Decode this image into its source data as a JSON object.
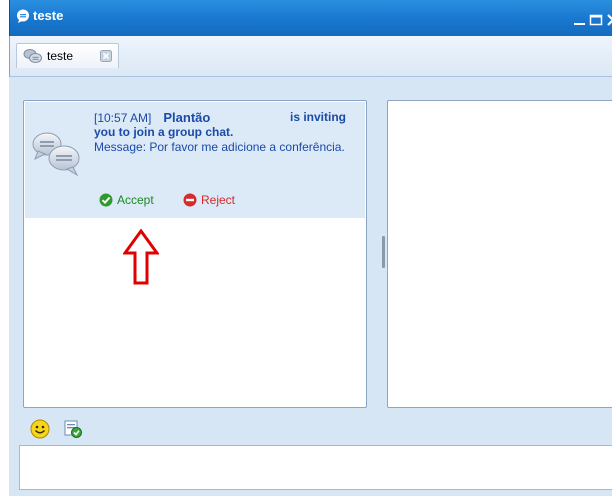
{
  "window": {
    "title": "teste",
    "colors": {
      "titlebar": "#1877cf",
      "chrome": "#d7e6f5",
      "message_bg": "#dce9f7",
      "link_text": "#1b4aa8",
      "accept": "#1a8a22",
      "reject": "#d42a2a",
      "arrow": "#e00000"
    }
  },
  "tabs": [
    {
      "label": "teste",
      "icon": "group-chat-icon"
    }
  ],
  "message": {
    "time": "[10:57 AM]",
    "sender": "Plantão",
    "invite_part1": "is inviting",
    "invite_part2": "you to join a group chat.",
    "body": "Message: Por favor me adicione a conferência.",
    "accept_label": "Accept",
    "reject_label": "Reject"
  },
  "toolbar": {
    "icons": [
      "smiley-icon",
      "format-icon"
    ]
  }
}
